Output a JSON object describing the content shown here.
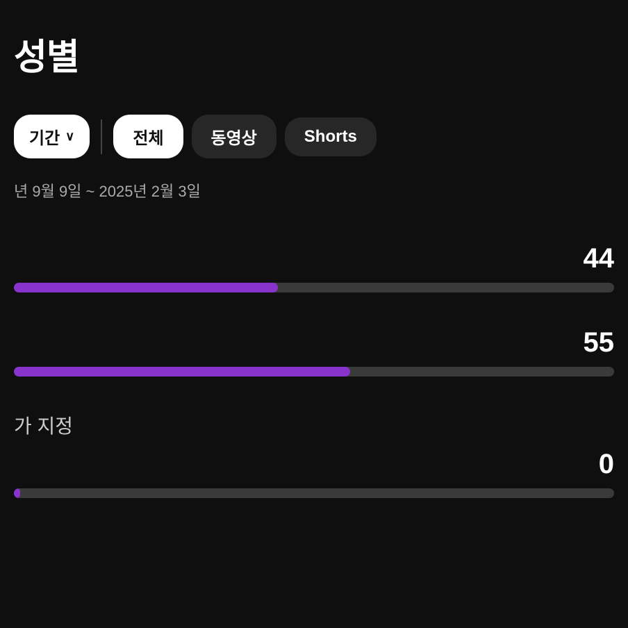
{
  "page": {
    "title": "성별",
    "date_range": "년 9월 9일 ~ 2025년 2월 3일",
    "filters": {
      "period_label": "기간",
      "period_suffix": "기간",
      "tabs": [
        {
          "id": "all",
          "label": "전체",
          "active": true
        },
        {
          "id": "video",
          "label": "동영상",
          "active": false
        },
        {
          "id": "shorts",
          "label": "Shorts",
          "active": false
        }
      ]
    },
    "stats": [
      {
        "id": "male",
        "value": "44",
        "bar_percent": 44,
        "label": ""
      },
      {
        "id": "female",
        "value": "55",
        "bar_percent": 56,
        "label": ""
      }
    ],
    "unknown": {
      "label": "가 지정",
      "value": "0",
      "bar_percent": 1
    },
    "colors": {
      "bar_fill": "#8833cc",
      "bar_bg": "#3a3a3a",
      "active_tab_bg": "#ffffff",
      "active_tab_color": "#0f0f0f",
      "inactive_tab_bg": "#272727",
      "inactive_tab_color": "#ffffff"
    }
  }
}
